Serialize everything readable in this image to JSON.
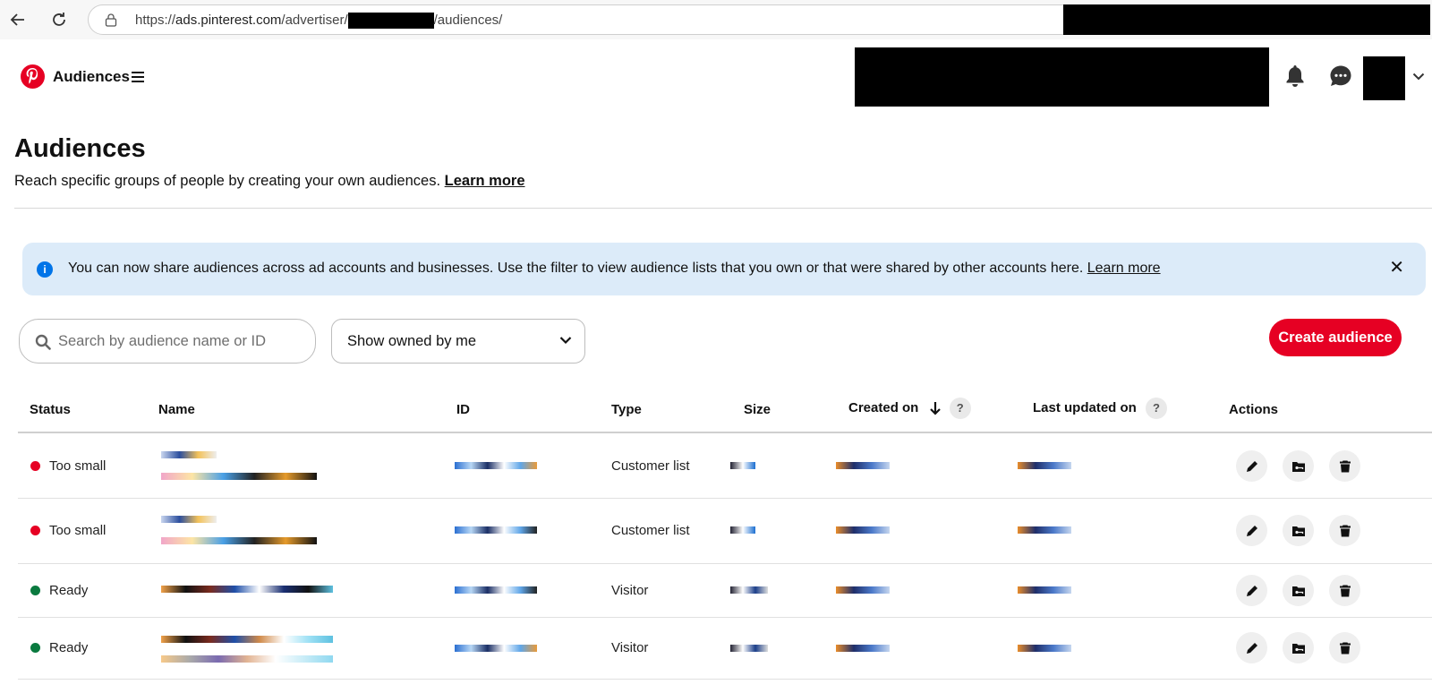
{
  "browser": {
    "url_prefix": "https://",
    "url_host": "ads.pinterest.com",
    "url_path_1": "/advertiser/",
    "url_path_2": "/audiences/"
  },
  "header": {
    "app_title": "Audiences"
  },
  "page": {
    "title": "Audiences",
    "subtitle": "Reach specific groups of people by creating your own audiences.",
    "learn_more": "Learn more"
  },
  "banner": {
    "text": "You can now share audiences across ad accounts and businesses. Use the filter to view audience lists that you own or that were shared by other accounts here.",
    "learn_more": "Learn more",
    "close": "✕"
  },
  "controls": {
    "search_placeholder": "Search by audience name or ID",
    "filter_value": "Show owned by me",
    "create_label": "Create audience"
  },
  "table": {
    "columns": {
      "status": "Status",
      "name": "Name",
      "id": "ID",
      "type": "Type",
      "size": "Size",
      "created_on": "Created on",
      "last_updated_on": "Last updated on",
      "actions": "Actions"
    },
    "rows": [
      {
        "status": "Too small",
        "status_color": "#e60023",
        "type": "Customer list"
      },
      {
        "status": "Too small",
        "status_color": "#e60023",
        "type": "Customer list"
      },
      {
        "status": "Ready",
        "status_color": "#0a7a3f",
        "type": "Visitor"
      },
      {
        "status": "Ready",
        "status_color": "#0a7a3f",
        "type": "Visitor"
      }
    ]
  },
  "colors": {
    "brand": "#e60023",
    "banner_bg": "#dcebf9",
    "info": "#0074e8"
  }
}
